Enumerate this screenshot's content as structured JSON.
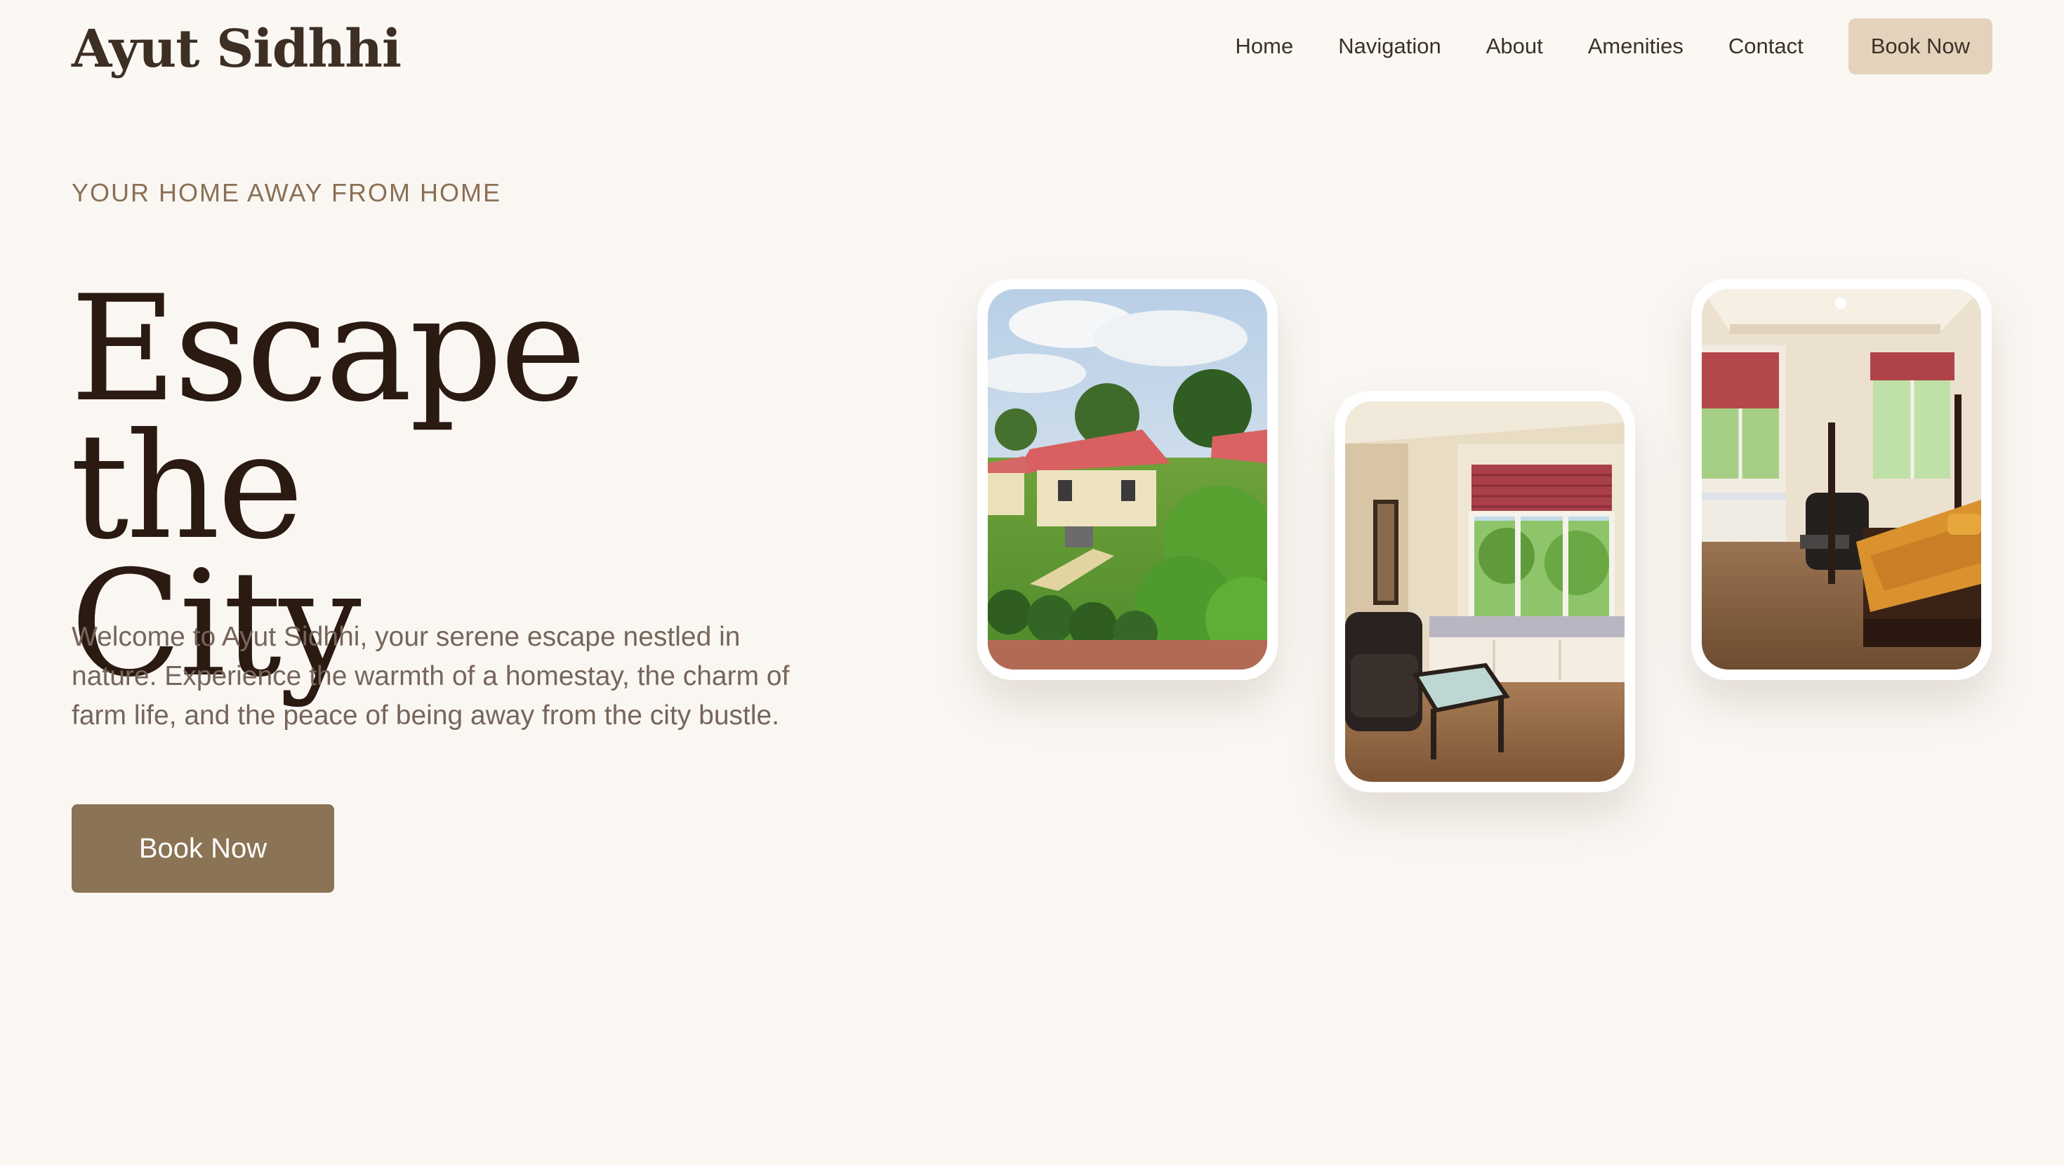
{
  "header": {
    "logo": "Ayut Sidhhi",
    "nav": [
      "Home",
      "Navigation",
      "About",
      "Amenities",
      "Contact"
    ],
    "cta_label": "Book Now"
  },
  "hero": {
    "eyebrow": "YOUR HOME AWAY FROM HOME",
    "headline_line1": "Escape the",
    "headline_line2": "City",
    "intro": "Welcome to Ayut Sidhhi, your serene escape nestled in nature. Experience the warmth of a homestay, the charm of farm life, and the peace of being away from the city bustle.",
    "cta_label": "Book Now"
  },
  "gallery": {
    "photos": [
      "exterior-cottage-garden-photo",
      "living-room-window-photo",
      "bedroom-photo"
    ]
  },
  "colors": {
    "background": "#faf7f3",
    "brand_brown": "#8b7355",
    "nav_cta_bg": "#e4d3bc",
    "headline": "#2b1a12"
  }
}
